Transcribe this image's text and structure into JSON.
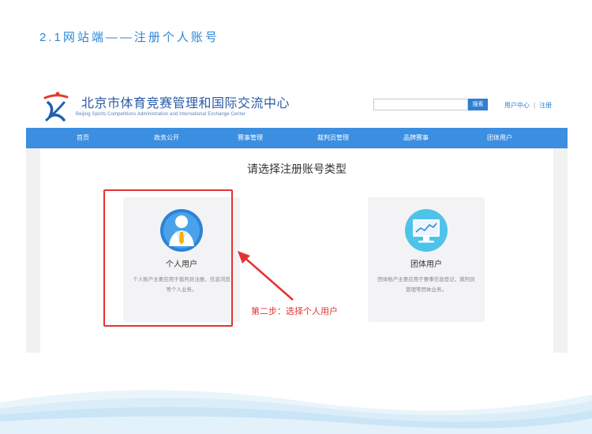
{
  "slide": {
    "title": "2.1网站端——注册个人账号"
  },
  "site": {
    "logo": {
      "cn": "北京市体育竞赛管理和国际交流中心",
      "en": "Beijing Sports Competitions Administration and International Exchange Center"
    },
    "search": {
      "placeholder": "",
      "button": "搜索"
    },
    "header_links": {
      "user_center": "用户中心",
      "separator": "|",
      "register": "注册"
    },
    "nav": [
      "首页",
      "政务公开",
      "赛事管理",
      "裁判员管理",
      "品牌赛事",
      "团体用户"
    ],
    "content": {
      "title": "请选择注册账号类型",
      "cards": [
        {
          "title": "个人用户",
          "desc": "个人账户主要应用于裁判员注册、信息浏览等个人业务。",
          "icon": "person-tie-icon"
        },
        {
          "title": "团体用户",
          "desc": "团体账户主要应用于赛事信息登记、裁判员管理等团体业务。",
          "icon": "monitor-chart-icon"
        }
      ]
    }
  },
  "annotation": {
    "step_label": "第二步：选择个人用户",
    "color": "#e53333"
  },
  "colors": {
    "accent": "#3b8ee0",
    "title": "#2b86d8"
  }
}
